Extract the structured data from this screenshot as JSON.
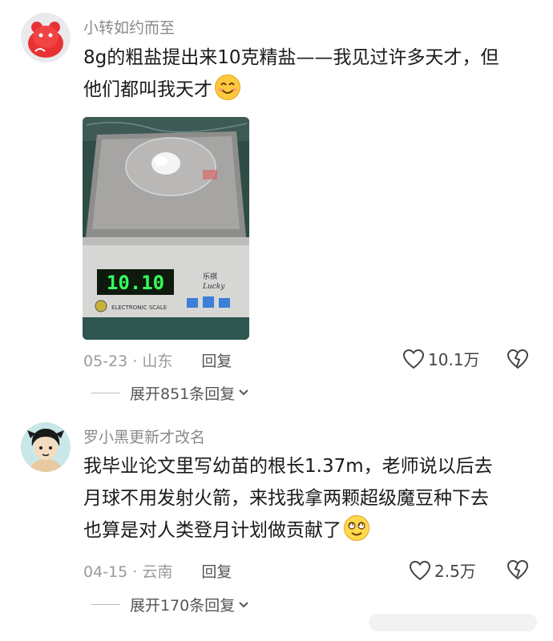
{
  "comments": [
    {
      "username": "小转如约而至",
      "text_line1": "8g的粗盐提出来10克精盐——我见过许多天才，但",
      "text_line2": "他们都叫我天才",
      "emoji": "smile-emoji",
      "photo": {
        "scale_display": "10.10",
        "brand_cn": "乐祺",
        "brand_en": "Lucky",
        "scale_label": "ELECTRONIC SCALE"
      },
      "date": "05-23",
      "location": "山东",
      "reply_label": "回复",
      "likes": "10.1万",
      "expand_label": "展开851条回复"
    },
    {
      "username": "罗小黑更新才改名",
      "text_line1": "我毕业论文里写幼苗的根长1.37m，老师说以后去",
      "text_line2": "月球不用发射火箭，来找我拿两颗超级魔豆种下去",
      "text_line3": "也算是对人类登月计划做贡献了",
      "emoji": "dizzy-smile-emoji",
      "date": "04-15",
      "location": "云南",
      "reply_label": "回复",
      "likes": "2.5万",
      "expand_label": "展开170条回复"
    }
  ],
  "separator": "·"
}
